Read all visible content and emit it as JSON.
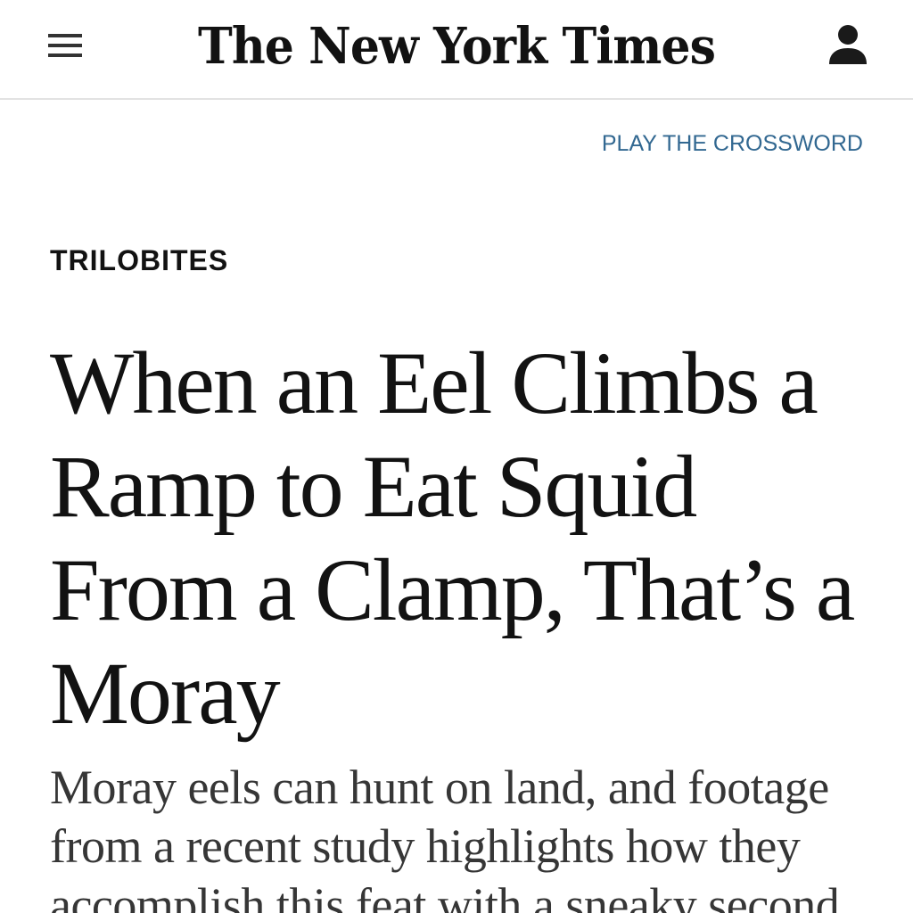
{
  "header": {
    "masthead": "The New York Times"
  },
  "nav": {
    "crossword_link": "PLAY THE CROSSWORD"
  },
  "article": {
    "kicker": "TRILOBITES",
    "headline": "When an Eel Climbs a Ramp to Eat Squid From a Clamp, That’s a Moray",
    "summary": "Moray eels can hunt on land, and footage from a recent study highlights how they accomplish this feat with a sneaky second"
  },
  "icons": {
    "menu": "hamburger-menu-icon",
    "account": "user-account-icon"
  },
  "colors": {
    "link": "#326891",
    "text": "#121212",
    "divider": "#e2e2e2"
  }
}
